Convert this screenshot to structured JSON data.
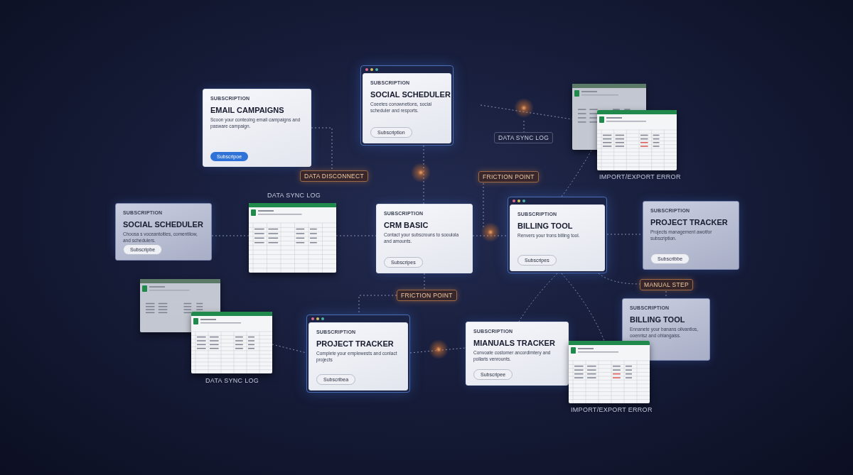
{
  "cards": [
    {
      "kind": "plain",
      "label": "SUBSCRIPTION",
      "title": "EMAIL CAMPAIGNS",
      "description": "Scoon your conteolng email campaigns and pasware campaign.",
      "button": {
        "label": "Subscripoe"
      }
    },
    {
      "kind": "chrome",
      "label": "SUBSCRIPTION",
      "title": "SOCIAL SCHEDULER",
      "description": "Coeetes conownetions, social scheduler and resports.",
      "button": {
        "label": "Subscription"
      }
    },
    {
      "kind": "plain",
      "label": "SUBSCRIPTION",
      "title": "SOCIAL SCHEDULER",
      "description": "Choosa s voceantoities, comentilow, and schedulers.",
      "button": {
        "label": "Subscripbe"
      }
    },
    {
      "kind": "plain",
      "label": "SUBSCRIPTION",
      "title": "CRM BASIC",
      "description": "Contact your subscrouns to sooulola and amounts.",
      "button": {
        "label": "Subscripes"
      }
    },
    {
      "kind": "chrome",
      "label": "SUBSCRIPTION",
      "title": "BILLING TOOL",
      "description": "Renvers your trons billing tool.",
      "button": {
        "label": "Subscripes"
      }
    },
    {
      "kind": "plain",
      "label": "SUBSCRIPTION",
      "title": "PROJECT TRACKER",
      "description": "Projects management awotfor subscription.",
      "button": {
        "label": "Subscribbe"
      }
    },
    {
      "kind": "chrome",
      "label": "SUBSCRIPTION",
      "title": "PROJECT TRACKER",
      "description": "Complete your emplewests and conlact projects",
      "button": {
        "label": "Subscribea"
      }
    },
    {
      "kind": "plain",
      "label": "SUBSCRIPTION",
      "title": "MIANUALS TRACKER",
      "description": "Convoate costomer ancordimtery and pollaris venrounts.",
      "button": {
        "label": "Subscripee"
      }
    },
    {
      "kind": "plain",
      "label": "SUBSCRIPTION",
      "title": "BILLING TOOL",
      "description": "Ennanete your banans oilvantlos, ooenrisz and ohlangaiss."
    }
  ],
  "tags": [
    {
      "kind": "info",
      "text": "DATA SYNC LOG"
    },
    {
      "kind": "warning",
      "text": "DATA DISCONNECT"
    },
    {
      "kind": "warning",
      "text": "FRICTION POINT"
    },
    {
      "kind": "caption",
      "text": "IMPORT/EXPORT ERROR"
    },
    {
      "kind": "caption",
      "text": "DATA SYNC LOG"
    },
    {
      "kind": "warning",
      "text": "MANUAL STEP"
    },
    {
      "kind": "warning",
      "text": "FRICTION POINT"
    },
    {
      "kind": "caption",
      "text": "DATA SYNC LOG"
    },
    {
      "kind": "caption",
      "text": "IMPORT/EXPORT ERROR"
    }
  ]
}
